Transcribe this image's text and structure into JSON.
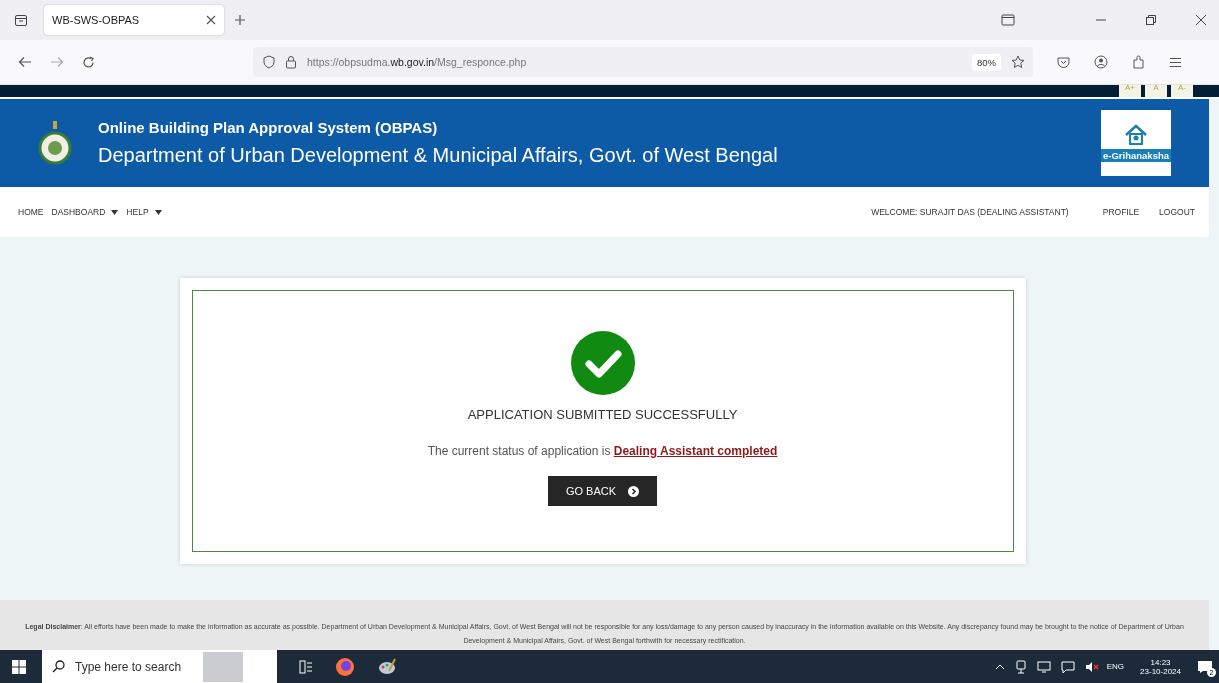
{
  "browser": {
    "tab_title": "WB-SWS-OBPAS",
    "url_prefix": "https://obpsudma.",
    "url_domain": "wb.gov.in",
    "url_path": "/Msg_responce.php",
    "zoom": "80%"
  },
  "font_controls": [
    "A+",
    "A",
    "A-"
  ],
  "header": {
    "title": "Online Building Plan Approval System (OBPAS)",
    "subtitle": "Department of Urban Development & Municipal Affairs, Govt. of West Bengal",
    "logo_text": "e-Grihanaksha"
  },
  "nav": {
    "left": [
      {
        "label": "HOME",
        "has_menu": false
      },
      {
        "label": "DASHBOARD",
        "has_menu": true
      },
      {
        "label": "HELP",
        "has_menu": true
      }
    ],
    "welcome": "WELCOME: SURAJIT DAS (DEALING ASSISTANT)",
    "right": [
      "PROFILE",
      "LOGOUT"
    ]
  },
  "message": {
    "heading": "APPLICATION SUBMITTED SUCCESSFULLY",
    "status_text": "The current status of application is ",
    "status_link": "Dealing Assistant completed",
    "button": "GO BACK"
  },
  "disclaimer": {
    "label": "Legal Disclaimer",
    "text": ": All efforts have been made to make the information as accurate as possible. Department of Urban Development & Municipal Affairs, Govt. of West Bengal will not be responsible for any loss/damage to any person caused by inaccuracy in the information available on this Website. Any discrepancy found may be brought to the notice of Department of Urban Development & Municipal Affairs, Govt. of West Bengal forthwith for necessary rectification."
  },
  "taskbar": {
    "search_placeholder": "Type here to search",
    "language": "ENG",
    "time": "14:23",
    "date": "23-10-2024",
    "notifications": "2"
  }
}
